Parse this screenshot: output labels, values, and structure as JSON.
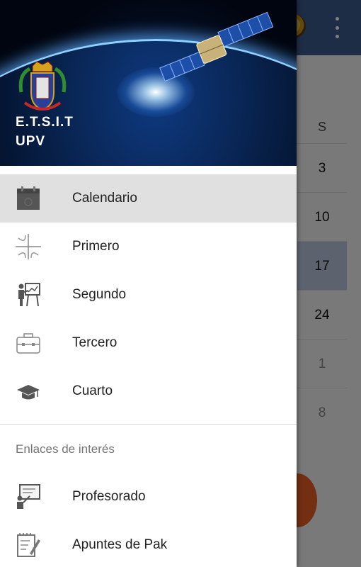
{
  "background": {
    "calendar_header": "S",
    "calendar_days": [
      "3",
      "10",
      "17",
      "24",
      "1",
      "8"
    ]
  },
  "drawer": {
    "header": {
      "title": "E.T.S.I.T",
      "subtitle": "UPV"
    },
    "nav_items": [
      {
        "label": "Calendario",
        "icon": "calendar-icon",
        "active": true
      },
      {
        "label": "Primero",
        "icon": "crossroads-icon",
        "active": false
      },
      {
        "label": "Segundo",
        "icon": "teacher-board-icon",
        "active": false
      },
      {
        "label": "Tercero",
        "icon": "briefcase-icon",
        "active": false
      },
      {
        "label": "Cuarto",
        "icon": "graduation-cap-icon",
        "active": false
      }
    ],
    "section_label": "Enlaces de interés",
    "links": [
      {
        "label": "Profesorado",
        "icon": "presenter-icon"
      },
      {
        "label": "Apuntes de Pak",
        "icon": "notes-pencil-icon"
      }
    ]
  },
  "colors": {
    "toolbar": "#3d5a8c",
    "active_item": "#e0e0e0",
    "fab": "#e95c22",
    "today_highlight": "#b9c7de"
  }
}
